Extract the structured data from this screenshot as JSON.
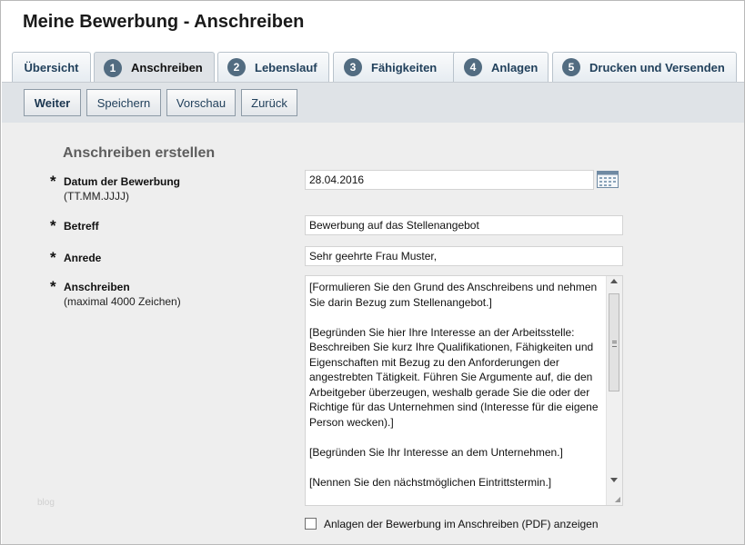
{
  "page": {
    "title": "Meine Bewerbung - Anschreiben"
  },
  "tabs": [
    {
      "label": "Übersicht",
      "num": ""
    },
    {
      "label": "Anschreiben",
      "num": "1"
    },
    {
      "label": "Lebenslauf",
      "num": "2"
    },
    {
      "label": "Fähigkeiten",
      "num": "3"
    },
    {
      "label": "Anlagen",
      "num": "4"
    },
    {
      "label": "Drucken und Versenden",
      "num": "5"
    }
  ],
  "active_tab": "Anschreiben",
  "toolbar": {
    "next": "Weiter",
    "save": "Speichern",
    "preview": "Vorschau",
    "back": "Zurück"
  },
  "form": {
    "section_title": "Anschreiben erstellen",
    "required_marker": "*",
    "date": {
      "label": "Datum der Bewerbung",
      "hint": "(TT.MM.JJJJ)",
      "value": "28.04.2016"
    },
    "subject": {
      "label": "Betreff",
      "value": "Bewerbung auf das Stellenangebot"
    },
    "salutation": {
      "label": "Anrede",
      "value": "Sehr geehrte Frau Muster,"
    },
    "letter": {
      "label": "Anschreiben",
      "hint": "(maximal 4000 Zeichen)",
      "value": "[Formulieren Sie den Grund des Anschreibens und nehmen Sie darin Bezug zum Stellenangebot.]\n\n[Begründen Sie hier Ihre Interesse an der Arbeitsstelle: Beschreiben Sie kurz Ihre Qualifikationen, Fähigkeiten und Eigenschaften mit Bezug zu den Anforderungen der angestrebten Tätigkeit. Führen Sie Argumente auf, die den Arbeitgeber überzeugen, weshalb gerade Sie die oder der Richtige für das Unternehmen sind (Interesse für die eigene Person wecken).]\n\n[Begründen Sie Ihr Interesse an dem Unternehmen.]\n\n[Nennen Sie den nächstmöglichen Eintrittstermin.]",
      "scroll_position": 0.0
    },
    "attachments_checkbox": {
      "label": "Anlagen der Bewerbung im Anschreiben (PDF) anzeigen",
      "checked": false
    }
  },
  "watermark": "blog",
  "colors": {
    "tab_text": "#22415c",
    "number_badge": "#526c81",
    "content_bg": "#eeeeee",
    "toolbar_bg": "#dfe3e7"
  }
}
